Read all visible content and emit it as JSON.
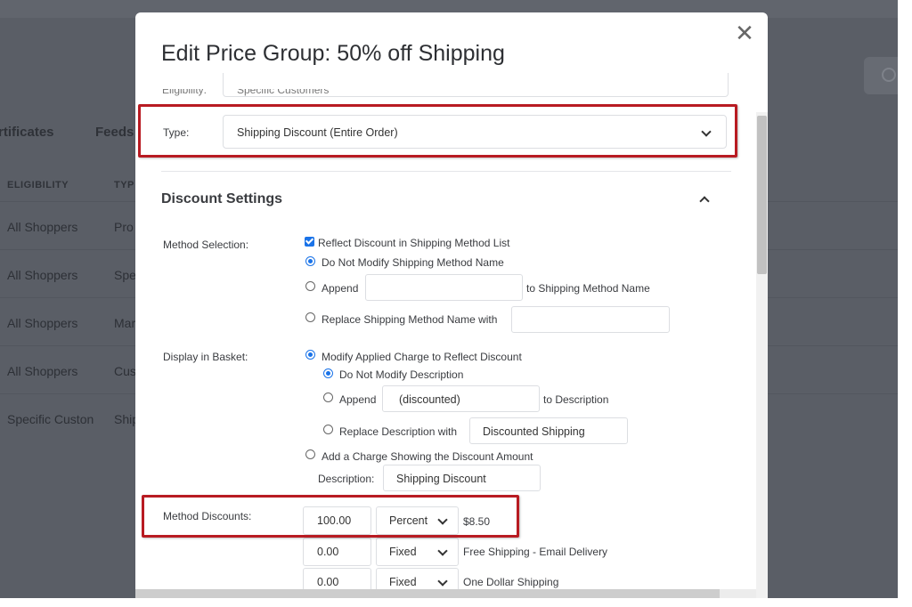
{
  "background": {
    "tabs": [
      "rtificates",
      "Feeds"
    ],
    "columns": [
      "ELIGIBILITY",
      "TYP"
    ],
    "rows": [
      {
        "eligibility": "All Shoppers",
        "type": "Pro"
      },
      {
        "eligibility": "All Shoppers",
        "type": "Spe"
      },
      {
        "eligibility": "All Shoppers",
        "type": "Mar"
      },
      {
        "eligibility": "All Shoppers",
        "type": "Cus"
      },
      {
        "eligibility": "Specific Custon",
        "type": "Ship"
      }
    ]
  },
  "modal": {
    "title": "Edit Price Group: 50% off Shipping",
    "close_icon": "close-icon",
    "eligibility_label_cut": "Eligibility:",
    "eligibility_value_cut": "Specific Customers",
    "type": {
      "label": "Type:",
      "value": "Shipping Discount (Entire Order)"
    },
    "section_title": "Discount Settings",
    "method_selection": {
      "label": "Method Selection:",
      "checkbox_label": "Reflect Discount in Shipping Method List",
      "opt_no_modify": "Do Not Modify Shipping Method Name",
      "opt_append": "Append",
      "opt_append_suffix": "to Shipping Method Name",
      "opt_append_value": "",
      "opt_replace": "Replace Shipping Method Name with",
      "opt_replace_value": ""
    },
    "display_in_basket": {
      "label": "Display in Basket:",
      "opt_modify_charge": "Modify Applied Charge to Reflect Discount",
      "opt_no_modify_desc": "Do Not Modify Description",
      "opt_append": "Append",
      "opt_append_value": "(discounted)",
      "opt_append_suffix": "to Description",
      "opt_replace": "Replace Description with",
      "opt_replace_value": "Discounted Shipping",
      "opt_add_charge": "Add a Charge Showing the Discount Amount",
      "description_label": "Description:",
      "description_value": "Shipping Discount"
    },
    "method_discounts": {
      "label": "Method Discounts:",
      "rows": [
        {
          "amount": "100.00",
          "mode": "Percent",
          "method": "$8.50"
        },
        {
          "amount": "0.00",
          "mode": "Fixed",
          "method": "Free Shipping - Email Delivery"
        },
        {
          "amount": "0.00",
          "mode": "Fixed",
          "method": "One Dollar Shipping"
        }
      ]
    },
    "colors": {
      "highlight": "#b81b22",
      "accent": "#1a73e8"
    }
  }
}
